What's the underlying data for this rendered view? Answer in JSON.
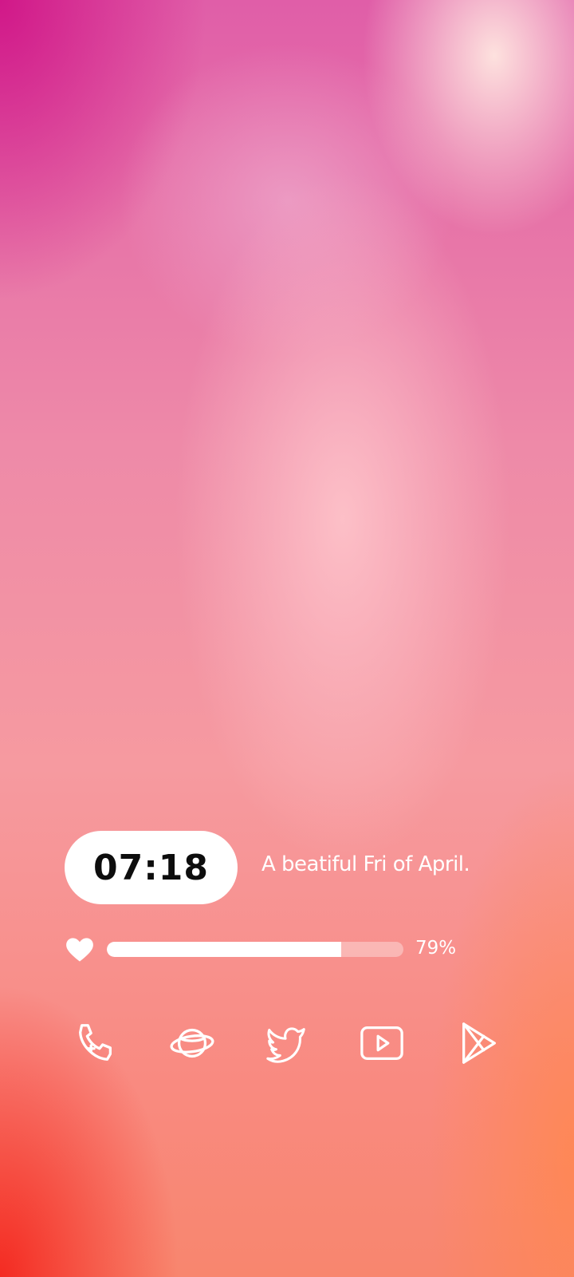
{
  "clock": {
    "time": "07:18"
  },
  "date": {
    "text": "A beatiful Fri of April."
  },
  "battery": {
    "level": 0.79,
    "percent_label": "79%",
    "icon": "heart-icon"
  },
  "dock": {
    "apps": [
      {
        "name": "phone",
        "icon": "phone-icon"
      },
      {
        "name": "browser",
        "icon": "planet-icon"
      },
      {
        "name": "twitter",
        "icon": "twitter-bird-icon"
      },
      {
        "name": "youtube",
        "icon": "youtube-play-icon"
      },
      {
        "name": "play-store",
        "icon": "play-store-icon"
      }
    ]
  },
  "colors": {
    "accent": "#ffffff",
    "clock_text": "#0d0d0d",
    "gradient_top_left": "#d0148b",
    "gradient_bottom_left": "#f4261e",
    "gradient_bottom_right": "#ff8750"
  }
}
